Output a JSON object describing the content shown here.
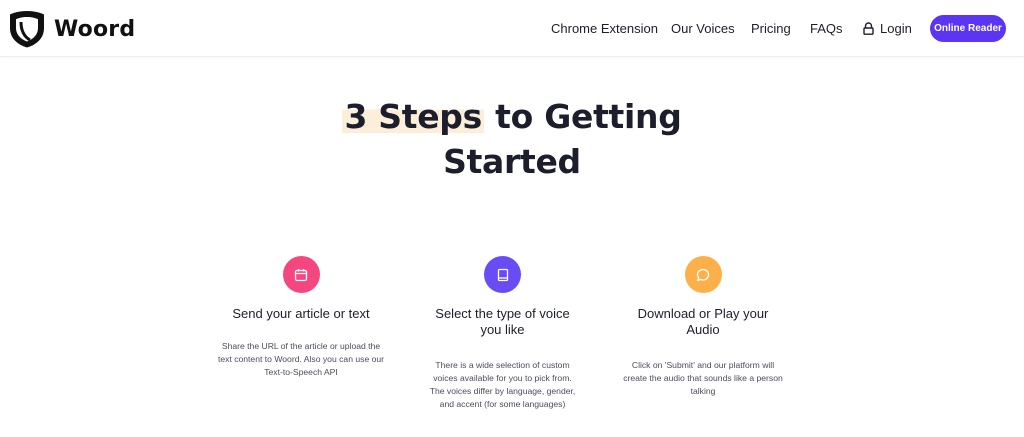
{
  "brand": {
    "name": "Woord"
  },
  "nav": {
    "items": [
      {
        "label": "Chrome Extension"
      },
      {
        "label": "Our Voices"
      },
      {
        "label": "Pricing"
      },
      {
        "label": "FAQs"
      }
    ],
    "login_label": "Login",
    "cta_label": "Online Reader"
  },
  "hero": {
    "title_highlight": "3 Steps",
    "title_rest_line1": " to Getting",
    "title_line2": "Started"
  },
  "steps": [
    {
      "icon": "calendar-icon",
      "color": "#f4467f",
      "title": "Send your article or text",
      "description": "Share the URL of the article or upload the text content to Woord. Also you can use our Text-to-Speech API"
    },
    {
      "icon": "book-icon",
      "color": "#6a4cf5",
      "title": "Select the type of voice you like",
      "description": "There is a wide selection of custom voices available for you to pick from. The voices differ by language, gender, and accent (for some languages)"
    },
    {
      "icon": "chat-bubble-icon",
      "color": "#fdb04a",
      "title": "Download or Play your Audio",
      "description": "Click on 'Submit' and our platform will create the audio that sounds like a person talking"
    }
  ],
  "colors": {
    "accent": "#5b34f4",
    "highlight": "#fdeed9",
    "text": "#1c1e2c"
  }
}
